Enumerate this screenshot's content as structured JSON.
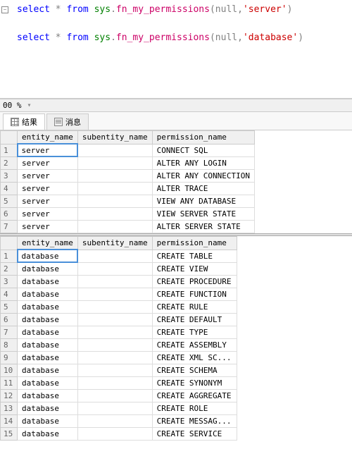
{
  "editor": {
    "line1": {
      "kw1": "select",
      "op1": "*",
      "kw2": "from",
      "ns": "sys",
      "dot": ".",
      "fn": "fn_my_permissions",
      "paren1": "(",
      "nul": "null",
      "comma": ",",
      "str": "'server'",
      "paren2": ")"
    },
    "line2": {
      "kw1": "select",
      "op1": "*",
      "kw2": "from",
      "ns": "sys",
      "dot": ".",
      "fn": "fn_my_permissions",
      "paren1": "(",
      "nul": "null",
      "comma": ",",
      "str": "'database'",
      "paren2": ")"
    }
  },
  "zoom": "00 %",
  "tabs": {
    "results": "结果",
    "messages": "消息"
  },
  "cols": {
    "entity": "entity_name",
    "subentity": "subentity_name",
    "permission": "permission_name"
  },
  "grid1": [
    {
      "n": "1",
      "e": "server",
      "s": "",
      "p": "CONNECT SQL"
    },
    {
      "n": "2",
      "e": "server",
      "s": "",
      "p": "ALTER ANY LOGIN"
    },
    {
      "n": "3",
      "e": "server",
      "s": "",
      "p": "ALTER ANY CONNECTION"
    },
    {
      "n": "4",
      "e": "server",
      "s": "",
      "p": "ALTER TRACE"
    },
    {
      "n": "5",
      "e": "server",
      "s": "",
      "p": "VIEW ANY DATABASE"
    },
    {
      "n": "6",
      "e": "server",
      "s": "",
      "p": "VIEW SERVER STATE"
    },
    {
      "n": "7",
      "e": "server",
      "s": "",
      "p": "ALTER SERVER STATE"
    }
  ],
  "grid2": [
    {
      "n": "1",
      "e": "database",
      "s": "",
      "p": "CREATE TABLE"
    },
    {
      "n": "2",
      "e": "database",
      "s": "",
      "p": "CREATE VIEW"
    },
    {
      "n": "3",
      "e": "database",
      "s": "",
      "p": "CREATE PROCEDURE"
    },
    {
      "n": "4",
      "e": "database",
      "s": "",
      "p": "CREATE FUNCTION"
    },
    {
      "n": "5",
      "e": "database",
      "s": "",
      "p": "CREATE RULE"
    },
    {
      "n": "6",
      "e": "database",
      "s": "",
      "p": "CREATE DEFAULT"
    },
    {
      "n": "7",
      "e": "database",
      "s": "",
      "p": "CREATE TYPE"
    },
    {
      "n": "8",
      "e": "database",
      "s": "",
      "p": "CREATE ASSEMBLY"
    },
    {
      "n": "9",
      "e": "database",
      "s": "",
      "p": "CREATE XML SC..."
    },
    {
      "n": "10",
      "e": "database",
      "s": "",
      "p": "CREATE SCHEMA"
    },
    {
      "n": "11",
      "e": "database",
      "s": "",
      "p": "CREATE SYNONYM"
    },
    {
      "n": "12",
      "e": "database",
      "s": "",
      "p": "CREATE AGGREGATE"
    },
    {
      "n": "13",
      "e": "database",
      "s": "",
      "p": "CREATE ROLE"
    },
    {
      "n": "14",
      "e": "database",
      "s": "",
      "p": "CREATE MESSAG..."
    },
    {
      "n": "15",
      "e": "database",
      "s": "",
      "p": "CREATE SERVICE"
    }
  ]
}
